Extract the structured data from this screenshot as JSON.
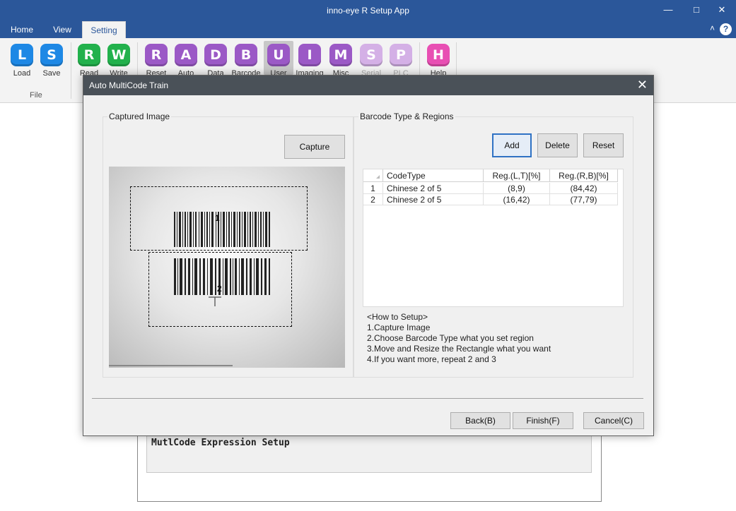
{
  "app": {
    "title": "inno-eye R Setup App"
  },
  "window_controls": {
    "minimize": "—",
    "maximize": "□",
    "close": "✕"
  },
  "tabs": [
    {
      "label": "Home"
    },
    {
      "label": "View"
    },
    {
      "label": "Setting"
    }
  ],
  "ribbon_right": {
    "collapse": "˄",
    "help": "?"
  },
  "ribbon": {
    "buttons": [
      {
        "letter": "L",
        "label": "Load",
        "color": "#1e88e5",
        "icon": "load-icon"
      },
      {
        "letter": "S",
        "label": "Save",
        "color": "#1e88e5",
        "icon": "save-icon"
      },
      {
        "letter": "R",
        "label": "Read",
        "color": "#22b14c",
        "icon": "read-icon"
      },
      {
        "letter": "W",
        "label": "Write",
        "color": "#22b14c",
        "icon": "write-icon"
      },
      {
        "letter": "R",
        "label": "Reset",
        "color": "#9b59c6",
        "icon": "reset-icon"
      },
      {
        "letter": "A",
        "label": "Auto",
        "color": "#9b59c6",
        "icon": "auto-icon"
      },
      {
        "letter": "D",
        "label": "Data",
        "color": "#9b59c6",
        "icon": "data-icon"
      },
      {
        "letter": "B",
        "label": "Barcode",
        "color": "#9b59c6",
        "icon": "barcode-icon"
      },
      {
        "letter": "U",
        "label": "User",
        "color": "#9b59c6",
        "icon": "user-icon"
      },
      {
        "letter": "I",
        "label": "Imaging",
        "color": "#9b59c6",
        "icon": "imaging-icon"
      },
      {
        "letter": "M",
        "label": "Misc",
        "color": "#9b59c6",
        "icon": "misc-icon"
      },
      {
        "letter": "S",
        "label": "Serial",
        "color": "#d4b0e6",
        "icon": "serial-icon"
      },
      {
        "letter": "P",
        "label": "PLC",
        "color": "#d4b0e6",
        "icon": "plc-icon"
      },
      {
        "letter": "H",
        "label": "Help",
        "color": "#e84fb3",
        "icon": "help-icon"
      }
    ],
    "group_file": "File"
  },
  "background": {
    "section_title": "MutlCode Expression Setup"
  },
  "dialog": {
    "title": "Auto MultiCode Train",
    "close": "✕",
    "captured": {
      "legend": "Captured Image",
      "capture_button": "Capture",
      "regions": [
        "1",
        "2"
      ]
    },
    "barcode": {
      "legend": "Barcode Type & Regions",
      "add": "Add",
      "delete": "Delete",
      "reset": "Reset",
      "columns": [
        "CodeType",
        "Reg.(L,T)[%]",
        "Reg.(R,B)[%]"
      ],
      "rows": [
        {
          "n": "1",
          "type": "Chinese 2 of 5",
          "lt": "(8,9)",
          "rb": "(84,42)"
        },
        {
          "n": "2",
          "type": "Chinese 2 of 5",
          "lt": "(16,42)",
          "rb": "(77,79)"
        }
      ],
      "howto": [
        "<How to Setup>",
        "1.Capture Image",
        "2.Choose Barcode Type what you set region",
        "3.Move and Resize the Rectangle what you want",
        "4.If you want more, repeat 2 and 3"
      ]
    },
    "footer": {
      "back": "Back(B)",
      "finish": "Finish(F)",
      "cancel": "Cancel(C)"
    }
  }
}
